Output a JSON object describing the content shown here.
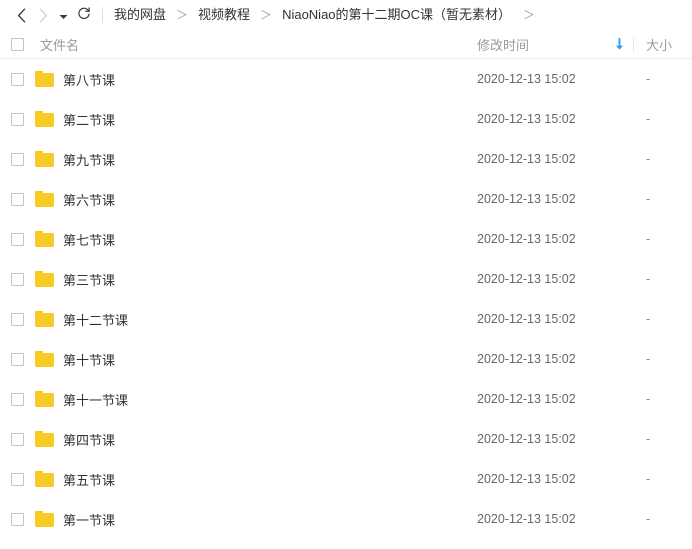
{
  "toolbar": {
    "back_icon": "chevron-left-icon",
    "forward_icon": "chevron-right-icon",
    "dropdown_icon": "caret-down-icon",
    "refresh_icon": "refresh-icon"
  },
  "breadcrumb": {
    "items": [
      {
        "label": "我的网盘"
      },
      {
        "label": "视频教程"
      },
      {
        "label": "NiaoNiao的第十二期OC课（暂无素材）"
      }
    ],
    "separator": "＞",
    "trailing_separator": "＞"
  },
  "header": {
    "select_all_checkbox": "",
    "name_label": "文件名",
    "time_label": "修改时间",
    "sort_icon": "sort-descending-arrow-icon",
    "sort_color": "#2e9bf0",
    "size_label": "大小"
  },
  "colors": {
    "folder": "#f8cb26",
    "folder_tab": "#f5c518",
    "text": "#333333",
    "muted": "#9b9b9b",
    "accent": "#2e9bf0",
    "divider": "#ededed"
  },
  "rows": [
    {
      "name": "第八节课",
      "time": "2020-12-13 15:02",
      "size": "-"
    },
    {
      "name": "第二节课",
      "time": "2020-12-13 15:02",
      "size": "-"
    },
    {
      "name": "第九节课",
      "time": "2020-12-13 15:02",
      "size": "-"
    },
    {
      "name": "第六节课",
      "time": "2020-12-13 15:02",
      "size": "-"
    },
    {
      "name": "第七节课",
      "time": "2020-12-13 15:02",
      "size": "-"
    },
    {
      "name": "第三节课",
      "time": "2020-12-13 15:02",
      "size": "-"
    },
    {
      "name": "第十二节课",
      "time": "2020-12-13 15:02",
      "size": "-"
    },
    {
      "name": "第十节课",
      "time": "2020-12-13 15:02",
      "size": "-"
    },
    {
      "name": "第十一节课",
      "time": "2020-12-13 15:02",
      "size": "-"
    },
    {
      "name": "第四节课",
      "time": "2020-12-13 15:02",
      "size": "-"
    },
    {
      "name": "第五节课",
      "time": "2020-12-13 15:02",
      "size": "-"
    },
    {
      "name": "第一节课",
      "time": "2020-12-13 15:02",
      "size": "-"
    }
  ]
}
